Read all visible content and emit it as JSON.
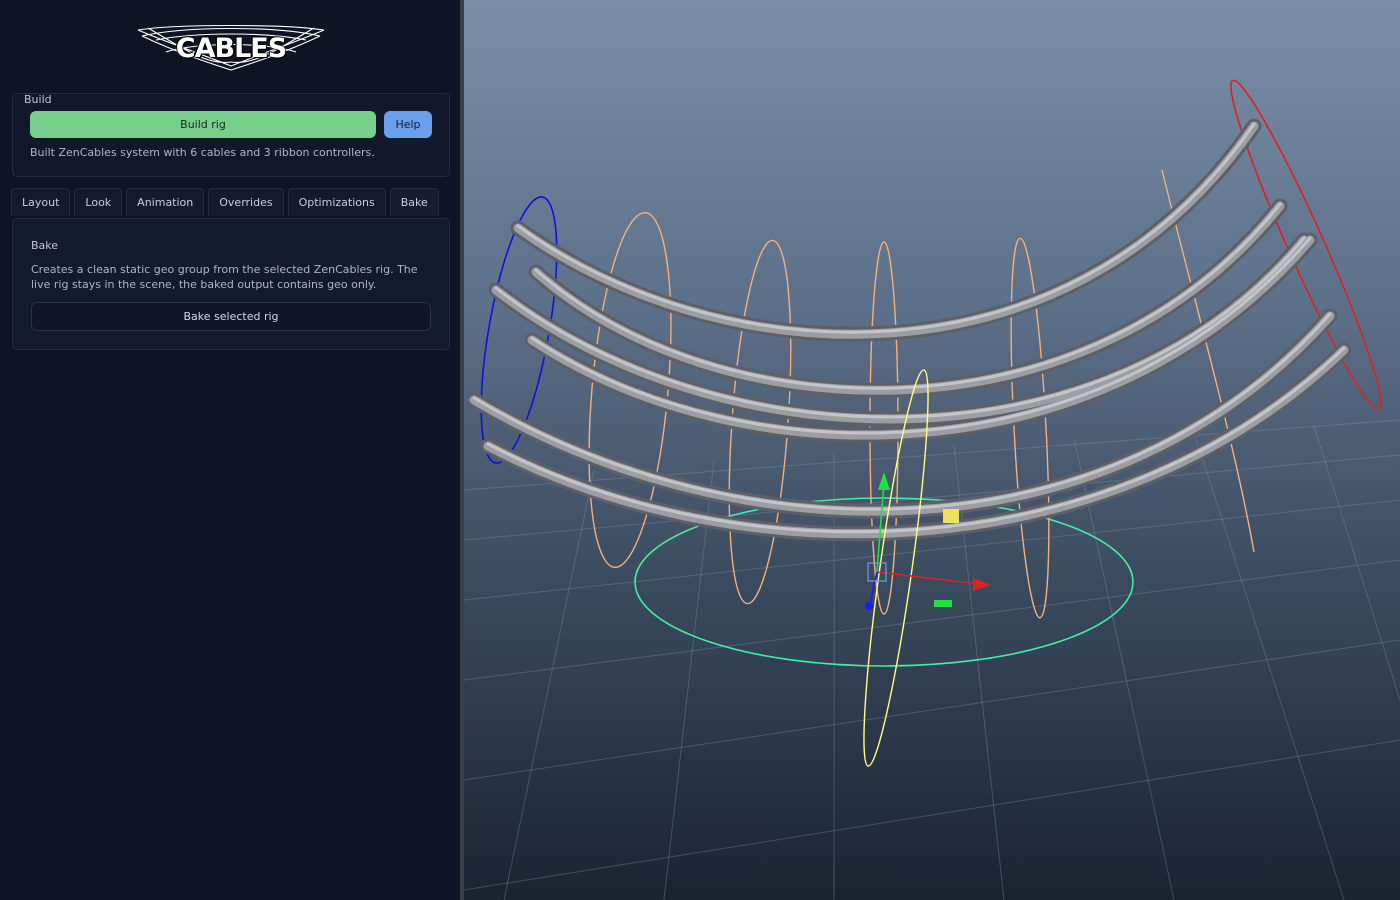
{
  "logo": {
    "text": "CABLES"
  },
  "build": {
    "group_title": "Build",
    "build_button": "Build rig",
    "help_button": "Help",
    "status": "Built ZenCables system with 6 cables and 3 ribbon controllers."
  },
  "tabs": [
    {
      "label": "Layout"
    },
    {
      "label": "Look"
    },
    {
      "label": "Animation"
    },
    {
      "label": "Overrides"
    },
    {
      "label": "Optimizations"
    },
    {
      "label": "Bake",
      "active": true
    }
  ],
  "bake": {
    "title": "Bake",
    "description": "Creates a clean static geo group from the selected ZenCables rig. The live rig stays in the scene, the baked output contains geo only.",
    "button": "Bake selected rig"
  },
  "colors": {
    "build_button": "#76d08c",
    "help_button": "#6aa0ea",
    "panel_bg": "#0f1424",
    "control_orange": "#f5b07a",
    "control_red": "#e02020",
    "control_blue": "#1010e0",
    "control_yellow": "#ffff80",
    "control_green": "#40f0a0"
  }
}
